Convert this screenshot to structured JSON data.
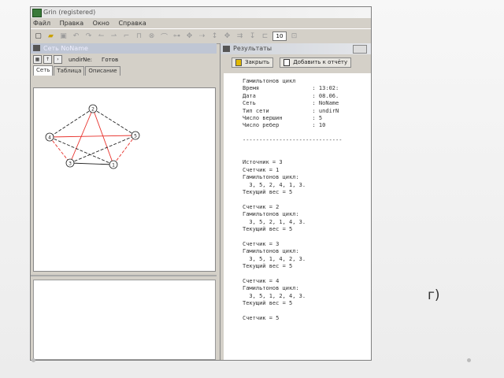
{
  "app": {
    "title": "Grin (registered)",
    "menu": [
      "Файл",
      "Правка",
      "Окно",
      "Справка"
    ],
    "zoom_value": "10"
  },
  "graph_window": {
    "title": "Сеть NoName",
    "undir_label": "undirNe:",
    "status": "Готов",
    "tabs": [
      "Сеть",
      "Таблица",
      "Описание"
    ],
    "vertices": [
      "1",
      "2",
      "3",
      "4",
      "5"
    ],
    "colors": {
      "edge_dashed": "#222222",
      "cycle_red": "#e8302a"
    }
  },
  "results_window": {
    "title": "Результаты",
    "close_button": "Закрыть",
    "add_to_report_button": "Добавить к отчёту",
    "report_lines": [
      "Гамильтонов цикл",
      "Время                : 13:02:",
      "Дата                 : 08.06.",
      "Сеть                 : NoName",
      "Тип сети             : undirN",
      "Число вершин         : 5",
      "Число ребер          : 10",
      "",
      "------------------------------",
      "",
      "",
      "Источник = 3",
      "Счетчик = 1",
      "Гамильтонов цикл:",
      "  3, 5, 2, 4, 1, 3.",
      "Текущий вес = 5",
      "",
      "Счетчик = 2",
      "Гамильтонов цикл:",
      "  3, 5, 2, 1, 4, 3.",
      "Текущий вес = 5",
      "",
      "Счетчик = 3",
      "Гамильтонов цикл:",
      "  3, 5, 1, 4, 2, 3.",
      "Текущий вес = 5",
      "",
      "Счетчик = 4",
      "Гамильтонов цикл:",
      "  3, 5, 1, 2, 4, 3.",
      "Текущий вес = 5",
      "",
      "Счетчик = 5"
    ]
  },
  "slide": {
    "caption": "г)"
  }
}
